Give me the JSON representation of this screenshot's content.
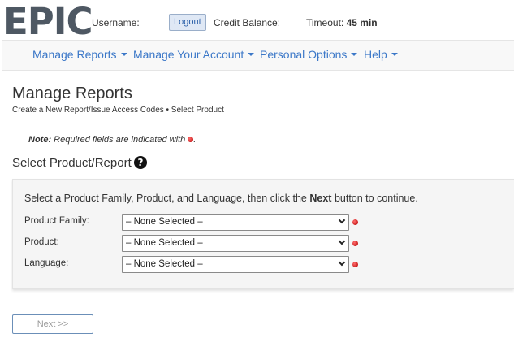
{
  "header": {
    "logo_text": "EPIC",
    "username_label": "Username:",
    "logout_label": "Logout",
    "credit_label": "Credit Balance:",
    "timeout_label": "Timeout:",
    "timeout_value": "45 min"
  },
  "nav": {
    "items": [
      {
        "label": "Manage Reports"
      },
      {
        "label": "Manage Your Account"
      },
      {
        "label": "Personal Options"
      },
      {
        "label": "Help"
      }
    ]
  },
  "page": {
    "title": "Manage Reports",
    "breadcrumb": "Create a New Report/Issue Access Codes • Select Product"
  },
  "note": {
    "prefix": "Note:",
    "text": "Required fields are indicated with",
    "suffix": "."
  },
  "section": {
    "title": "Select Product/Report",
    "help_icon": "question-circle-icon"
  },
  "form": {
    "instructions_pre": "Select a Product Family, Product, and Language, then click the",
    "instructions_bold": "Next",
    "instructions_post": "button to continue.",
    "fields": [
      {
        "label": "Product Family:",
        "value": "– None Selected –"
      },
      {
        "label": "Product:",
        "value": "– None Selected –"
      },
      {
        "label": "Language:",
        "value": "– None Selected –"
      }
    ]
  },
  "actions": {
    "next_label": "Next >>"
  },
  "colors": {
    "link": "#3c78c8",
    "required": "#cc0000",
    "logo": "#4e5863"
  }
}
